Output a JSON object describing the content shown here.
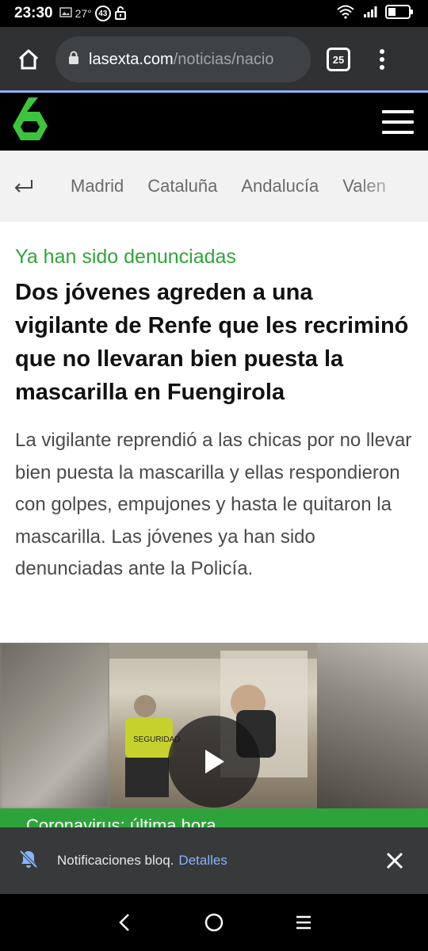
{
  "status_bar": {
    "time": "23:30",
    "temperature": "27°",
    "badge": "43",
    "icons": [
      "image-icon",
      "lock-open-icon",
      "wifi-icon",
      "signal-icon",
      "battery-icon"
    ]
  },
  "browser": {
    "url_domain": "lasexta.com",
    "url_path": "/noticias/nacio",
    "tab_count": "25"
  },
  "site": {
    "logo_color": "#3ec33e"
  },
  "region_nav": {
    "items": [
      "Madrid",
      "Cataluña",
      "Andalucía",
      "Valen"
    ]
  },
  "article": {
    "kicker": "Ya han sido denunciadas",
    "headline": "Dos jóvenes agreden a una vigilante de Renfe que les recriminó que no llevaran bien puesta la mascarilla en Fuengirola",
    "summary": "La vigilante reprendió a las chicas por no llevar bien puesta la mascarilla y ellas respondieron con golpes, empujones y hasta le quitaron la mascarilla. Las jóvenes ya han sido denunciadas ante la Policía."
  },
  "ticker": {
    "text": "Coronavirus: última hora"
  },
  "notification": {
    "text": "Notificaciones bloq.",
    "link": "Detalles"
  },
  "colors": {
    "accent_green": "#33a33b",
    "link_blue": "#8ab4f8"
  }
}
